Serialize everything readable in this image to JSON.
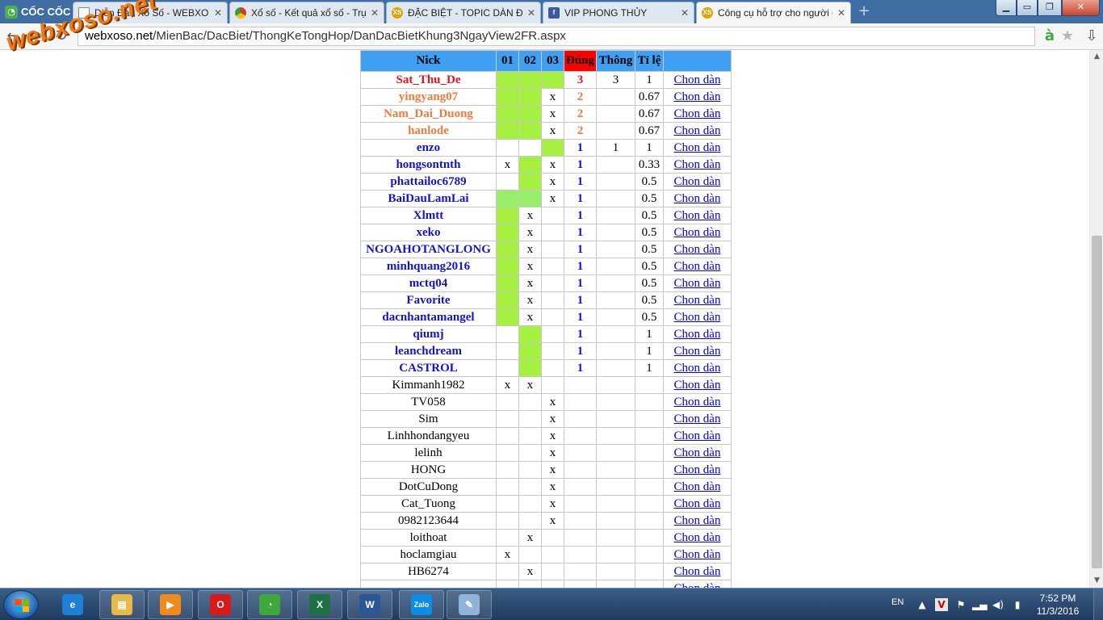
{
  "browser": {
    "logo_text": "CỐC CỐC",
    "tabs": [
      {
        "title": "Diễn Đàn Xổ Số - WEBXOSO - DIENDAN",
        "icon": "document-icon",
        "color": "#ffffff"
      },
      {
        "title": "Xổ số - Kết quả xổ số - Trực tiếp",
        "icon": "chrome-icon",
        "color": "#d23f31"
      },
      {
        "title": "ĐẶC BIỆT - TOPIC DÀN ĐẶC BIỆT",
        "icon": "xs-icon",
        "color": "#e0a400"
      },
      {
        "title": "VIP PHONG THỦY",
        "icon": "facebook-icon",
        "color": "#3b5998"
      },
      {
        "title": "Công cụ hỗ trợ cho người chơi",
        "icon": "xs-icon",
        "color": "#e0a400"
      }
    ],
    "url_host": "webxoso.net",
    "url_path": "/MienBac/DacBiet/ThongKeTongHop/DanDacBietKhung3NgayView2FR.aspx",
    "watermark": "webxoso.net"
  },
  "table": {
    "headers": {
      "nick": "Nick",
      "d1": "01",
      "d2": "02",
      "d3": "03",
      "dung": "Đúng",
      "thong": "Thông",
      "tile": "Tỉ lệ",
      "action": ""
    },
    "link_label": "Chon dàn",
    "rows": [
      {
        "nick": "Sat_Thu_De",
        "c1": "",
        "c2": "",
        "c3": "",
        "g": [
          1,
          1,
          1
        ],
        "dung": "3",
        "thong": "3",
        "tile": "1",
        "color": "#e8101a"
      },
      {
        "nick": "yingyang07",
        "c1": "",
        "c2": "",
        "c3": "x",
        "g": [
          1,
          1,
          0
        ],
        "dung": "2",
        "thong": "",
        "tile": "0.67",
        "color": "#f07a3c"
      },
      {
        "nick": "Nam_Dai_Duong",
        "c1": "",
        "c2": "",
        "c3": "x",
        "g": [
          1,
          1,
          0
        ],
        "dung": "2",
        "thong": "",
        "tile": "0.67",
        "color": "#f07a3c"
      },
      {
        "nick": "hanlode",
        "c1": "",
        "c2": "",
        "c3": "x",
        "g": [
          1,
          1,
          0
        ],
        "dung": "2",
        "thong": "",
        "tile": "0.67",
        "color": "#f07a3c"
      },
      {
        "nick": "enzo",
        "c1": "",
        "c2": "",
        "c3": "",
        "g": [
          0,
          0,
          1
        ],
        "dung": "1",
        "thong": "1",
        "tile": "1",
        "color": "#1212d6"
      },
      {
        "nick": "hongsontnth",
        "c1": "x",
        "c2": "",
        "c3": "x",
        "g": [
          0,
          1,
          0
        ],
        "dung": "1",
        "thong": "",
        "tile": "0.33",
        "color": "#1212d6"
      },
      {
        "nick": "phattailoc6789",
        "c1": "",
        "c2": "",
        "c3": "x",
        "g": [
          0,
          1,
          0
        ],
        "dung": "1",
        "thong": "",
        "tile": "0.5",
        "color": "#1212d6"
      },
      {
        "nick": "BaiDauLamLai",
        "c1": "",
        "c2": "",
        "c3": "x",
        "g": [
          2,
          2,
          0
        ],
        "dung": "1",
        "thong": "",
        "tile": "0.5",
        "color": "#1212d6"
      },
      {
        "nick": "Xlmtt",
        "c1": "",
        "c2": "x",
        "c3": "",
        "g": [
          1,
          0,
          0
        ],
        "dung": "1",
        "thong": "",
        "tile": "0.5",
        "color": "#1212d6"
      },
      {
        "nick": "xeko",
        "c1": "",
        "c2": "x",
        "c3": "",
        "g": [
          1,
          0,
          0
        ],
        "dung": "1",
        "thong": "",
        "tile": "0.5",
        "color": "#1212d6"
      },
      {
        "nick": "NGOAHOTANGLONG",
        "c1": "",
        "c2": "x",
        "c3": "",
        "g": [
          1,
          0,
          0
        ],
        "dung": "1",
        "thong": "",
        "tile": "0.5",
        "color": "#1212d6"
      },
      {
        "nick": "minhquang2016",
        "c1": "",
        "c2": "x",
        "c3": "",
        "g": [
          1,
          0,
          0
        ],
        "dung": "1",
        "thong": "",
        "tile": "0.5",
        "color": "#1212d6"
      },
      {
        "nick": "mctq04",
        "c1": "",
        "c2": "x",
        "c3": "",
        "g": [
          1,
          0,
          0
        ],
        "dung": "1",
        "thong": "",
        "tile": "0.5",
        "color": "#1212d6"
      },
      {
        "nick": "Favorite",
        "c1": "",
        "c2": "x",
        "c3": "",
        "g": [
          1,
          0,
          0
        ],
        "dung": "1",
        "thong": "",
        "tile": "0.5",
        "color": "#1212d6"
      },
      {
        "nick": "dacnhantamangel",
        "c1": "",
        "c2": "x",
        "c3": "",
        "g": [
          1,
          0,
          0
        ],
        "dung": "1",
        "thong": "",
        "tile": "0.5",
        "color": "#1212d6"
      },
      {
        "nick": "qiumj",
        "c1": "",
        "c2": "",
        "c3": "",
        "g": [
          0,
          1,
          0
        ],
        "dung": "1",
        "thong": "",
        "tile": "1",
        "color": "#1212d6"
      },
      {
        "nick": "leanchdream",
        "c1": "",
        "c2": "",
        "c3": "",
        "g": [
          0,
          1,
          0
        ],
        "dung": "1",
        "thong": "",
        "tile": "1",
        "color": "#1212d6"
      },
      {
        "nick": "CASTROL",
        "c1": "",
        "c2": "",
        "c3": "",
        "g": [
          0,
          1,
          0
        ],
        "dung": "1",
        "thong": "",
        "tile": "1",
        "color": "#1212d6"
      },
      {
        "nick": "Kimmanh1982",
        "c1": "x",
        "c2": "x",
        "c3": "",
        "g": [
          0,
          0,
          0
        ],
        "dung": "",
        "thong": "",
        "tile": "",
        "color": ""
      },
      {
        "nick": "TV058",
        "c1": "",
        "c2": "",
        "c3": "x",
        "g": [
          0,
          0,
          0
        ],
        "dung": "",
        "thong": "",
        "tile": "",
        "color": ""
      },
      {
        "nick": "Sim",
        "c1": "",
        "c2": "",
        "c3": "x",
        "g": [
          0,
          0,
          0
        ],
        "dung": "",
        "thong": "",
        "tile": "",
        "color": ""
      },
      {
        "nick": "Linhhondangyeu",
        "c1": "",
        "c2": "",
        "c3": "x",
        "g": [
          0,
          0,
          0
        ],
        "dung": "",
        "thong": "",
        "tile": "",
        "color": ""
      },
      {
        "nick": "lelinh",
        "c1": "",
        "c2": "",
        "c3": "x",
        "g": [
          0,
          0,
          0
        ],
        "dung": "",
        "thong": "",
        "tile": "",
        "color": ""
      },
      {
        "nick": "HONG",
        "c1": "",
        "c2": "",
        "c3": "x",
        "g": [
          0,
          0,
          0
        ],
        "dung": "",
        "thong": "",
        "tile": "",
        "color": ""
      },
      {
        "nick": "DotCuDong",
        "c1": "",
        "c2": "",
        "c3": "x",
        "g": [
          0,
          0,
          0
        ],
        "dung": "",
        "thong": "",
        "tile": "",
        "color": ""
      },
      {
        "nick": "Cat_Tuong",
        "c1": "",
        "c2": "",
        "c3": "x",
        "g": [
          0,
          0,
          0
        ],
        "dung": "",
        "thong": "",
        "tile": "",
        "color": ""
      },
      {
        "nick": "0982123644",
        "c1": "",
        "c2": "",
        "c3": "x",
        "g": [
          0,
          0,
          0
        ],
        "dung": "",
        "thong": "",
        "tile": "",
        "color": ""
      },
      {
        "nick": "loithoat",
        "c1": "",
        "c2": "x",
        "c3": "",
        "g": [
          0,
          0,
          0
        ],
        "dung": "",
        "thong": "",
        "tile": "",
        "color": ""
      },
      {
        "nick": "hoclamgiau",
        "c1": "x",
        "c2": "",
        "c3": "",
        "g": [
          0,
          0,
          0
        ],
        "dung": "",
        "thong": "",
        "tile": "",
        "color": ""
      },
      {
        "nick": "HB6274",
        "c1": "",
        "c2": "x",
        "c3": "",
        "g": [
          0,
          0,
          0
        ],
        "dung": "",
        "thong": "",
        "tile": "",
        "color": ""
      },
      {
        "nick": "",
        "c1": "",
        "c2": "",
        "c3": "",
        "g": [
          0,
          0,
          0
        ],
        "dung": "",
        "thong": "",
        "tile": "",
        "color": ""
      }
    ]
  },
  "taskbar": {
    "apps": [
      {
        "name": "internet-explorer-icon",
        "label": "e",
        "color": "#1e7fd6"
      },
      {
        "name": "file-explorer-icon",
        "label": "▤",
        "color": "#e7b84a"
      },
      {
        "name": "media-player-icon",
        "label": "▶",
        "color": "#f08a1c"
      },
      {
        "name": "opera-icon",
        "label": "O",
        "color": "#d91a1a"
      },
      {
        "name": "coccoc-icon",
        "label": "◔",
        "color": "#3fa83a"
      },
      {
        "name": "excel-icon",
        "label": "X",
        "color": "#1e7144"
      },
      {
        "name": "word-icon",
        "label": "W",
        "color": "#2b5797"
      },
      {
        "name": "zalo-icon",
        "label": "Zalo",
        "color": "#0a8ee6"
      },
      {
        "name": "paint-icon",
        "label": "✎",
        "color": "#8fb3d9"
      }
    ],
    "language": "EN",
    "time": "7:52 PM",
    "date": "11/3/2016"
  }
}
